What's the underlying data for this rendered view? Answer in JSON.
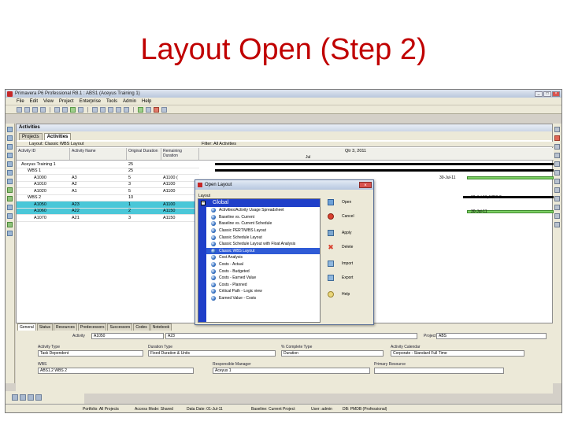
{
  "slide": {
    "title": "Layout Open (Step 2)"
  },
  "window": {
    "title": "Primavera P6 Professional R8.1 : ABS1 (Aceyus Training 1)",
    "menu": [
      "File",
      "Edit",
      "View",
      "Project",
      "Enterprise",
      "Tools",
      "Admin",
      "Help"
    ]
  },
  "pane": {
    "header": "Activities",
    "tabs": [
      "Projects",
      "Activities"
    ],
    "layout_label": "Layout: Classic WBS Layout",
    "filter_label": "Filter: All Activities",
    "columns": [
      "Activity ID",
      "Activity Name",
      "Original Duration",
      "Remaining Duration"
    ],
    "gantt_header": {
      "quarter": "Qtr 3, 2011",
      "month": "Jul"
    },
    "rows": [
      {
        "id": "Aceyus Training 1",
        "name": "",
        "od": "25",
        "rd": "",
        "kind": "wbs"
      },
      {
        "id": "WBS 1",
        "name": "",
        "od": "25",
        "rd": "",
        "kind": "wbs"
      },
      {
        "id": "A1000",
        "name": "A3",
        "od": "5",
        "rd": "A1100 (",
        "kind": "act"
      },
      {
        "id": "A1010",
        "name": "A2",
        "od": "3",
        "rd": "A1100",
        "kind": "act"
      },
      {
        "id": "A1020",
        "name": "A1",
        "od": "5",
        "rd": "A1100",
        "kind": "act"
      },
      {
        "id": "WBS 2",
        "name": "",
        "od": "10",
        "rd": "",
        "kind": "wbs"
      },
      {
        "id": "A1050",
        "name": "A23",
        "od": "1",
        "rd": "A1100",
        "kind": "sel"
      },
      {
        "id": "A1060",
        "name": "A22",
        "od": "2",
        "rd": "A1150",
        "kind": "sel"
      },
      {
        "id": "A1070",
        "name": "A21",
        "od": "3",
        "rd": "A1150",
        "kind": "act"
      }
    ],
    "gantt_labels": [
      "30-Jul-11",
      "30-Jul-11, WBS 2",
      "30-Jul-11"
    ]
  },
  "bottom_tabs": [
    "General",
    "Status",
    "Resources",
    "Predecessors",
    "Successors",
    "Codes",
    "Notebook"
  ],
  "details": {
    "activity_label": "Activity",
    "activity_id": "A1050",
    "activity_name": "A23",
    "project_label": "Project",
    "project_value": "ABS",
    "activity_type_label": "Activity Type",
    "activity_type": "Task Dependent",
    "duration_type_label": "Duration Type",
    "duration_type": "Fixed Duration & Units",
    "pct_type_label": "% Complete Type",
    "pct_type": "Duration",
    "calendar_label": "Activity Calendar",
    "calendar": "Corporate - Standard Full Time",
    "wbs_label": "WBS",
    "wbs": "ABS1.2 WBS 2",
    "manager_label": "Responsible Manager",
    "manager": "Aceyus 1",
    "resource_label": "Primary Resource",
    "resource": ""
  },
  "status": {
    "portfolio": "Portfolio: All Projects",
    "access": "Access Mode: Shared",
    "datadate": "Data Date: 01-Jul-11",
    "baseline": "Baseline: Current Project",
    "user": "User: admin",
    "db": "DB: PMDB (Professional)"
  },
  "dialog": {
    "title": "Open Layout",
    "layout_label": "Layout",
    "group": "Global",
    "items": [
      "Activities/Activity Usage Spreadsheet",
      "Baseline vs. Current",
      "Baseline vs. Current Schedule",
      "Classic PERT/WBS Layout",
      "Classic Schedule Layout",
      "Classic Schedule Layout with Float Analysis",
      "Classic WBS Layout",
      "Cost Analysis",
      "Costs - Actual",
      "Costs - Budgeted",
      "Costs - Earned Value",
      "Costs - Planned",
      "Critical Path - Logic view",
      "Earned Value - Costs"
    ],
    "selected_index": 6,
    "buttons": [
      "Open",
      "Cancel",
      "Apply",
      "Delete",
      "Import",
      "Export",
      "Help"
    ]
  }
}
